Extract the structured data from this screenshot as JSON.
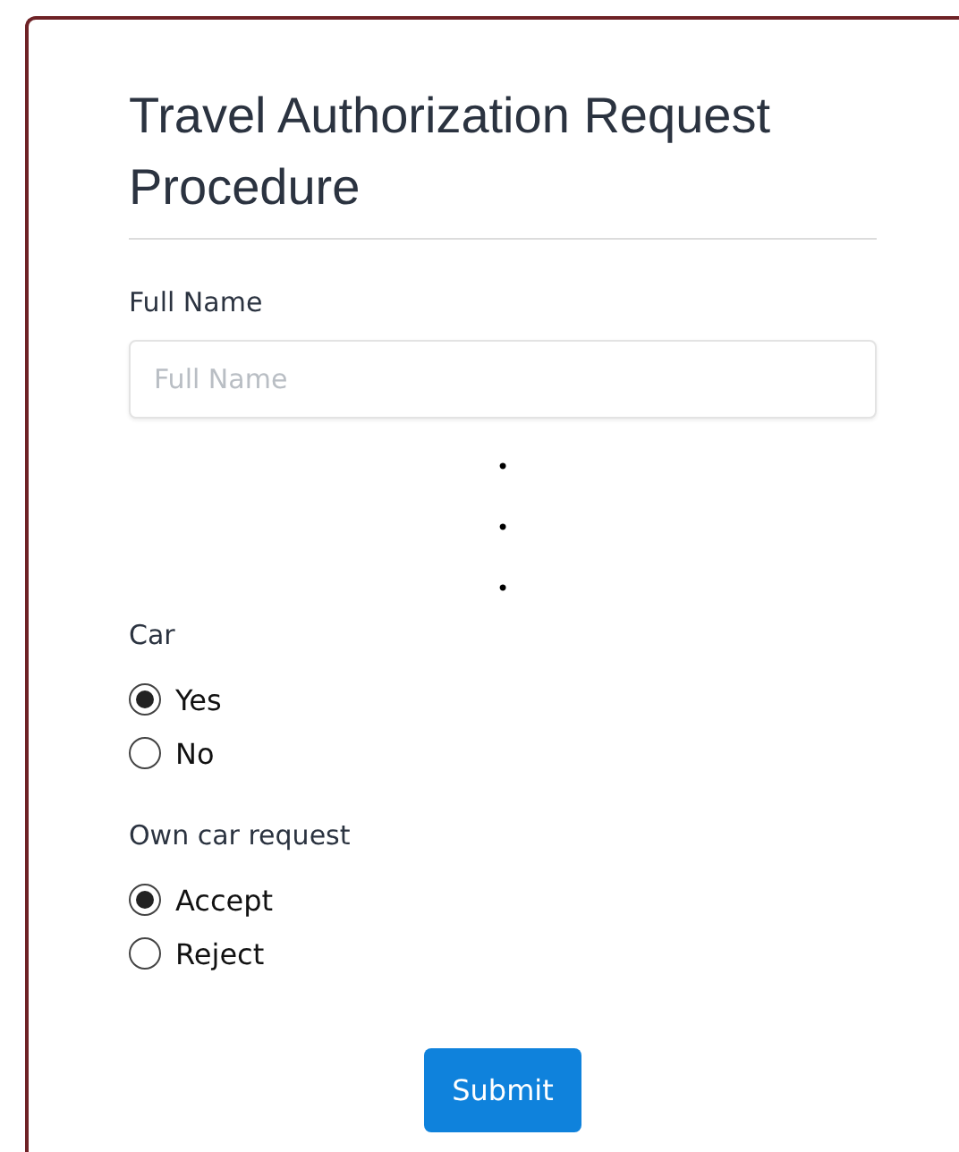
{
  "title": "Travel Authorization Request Procedure",
  "full_name": {
    "label": "Full Name",
    "placeholder": "Full Name"
  },
  "ellipsis": [
    "•",
    "•",
    "•"
  ],
  "groups": [
    {
      "label": "Car",
      "options": [
        {
          "label": "Yes",
          "selected": true
        },
        {
          "label": "No",
          "selected": false
        }
      ]
    },
    {
      "label": "Own car request",
      "options": [
        {
          "label": "Accept",
          "selected": true
        },
        {
          "label": "Reject",
          "selected": false
        }
      ]
    }
  ],
  "submit": "Submit"
}
